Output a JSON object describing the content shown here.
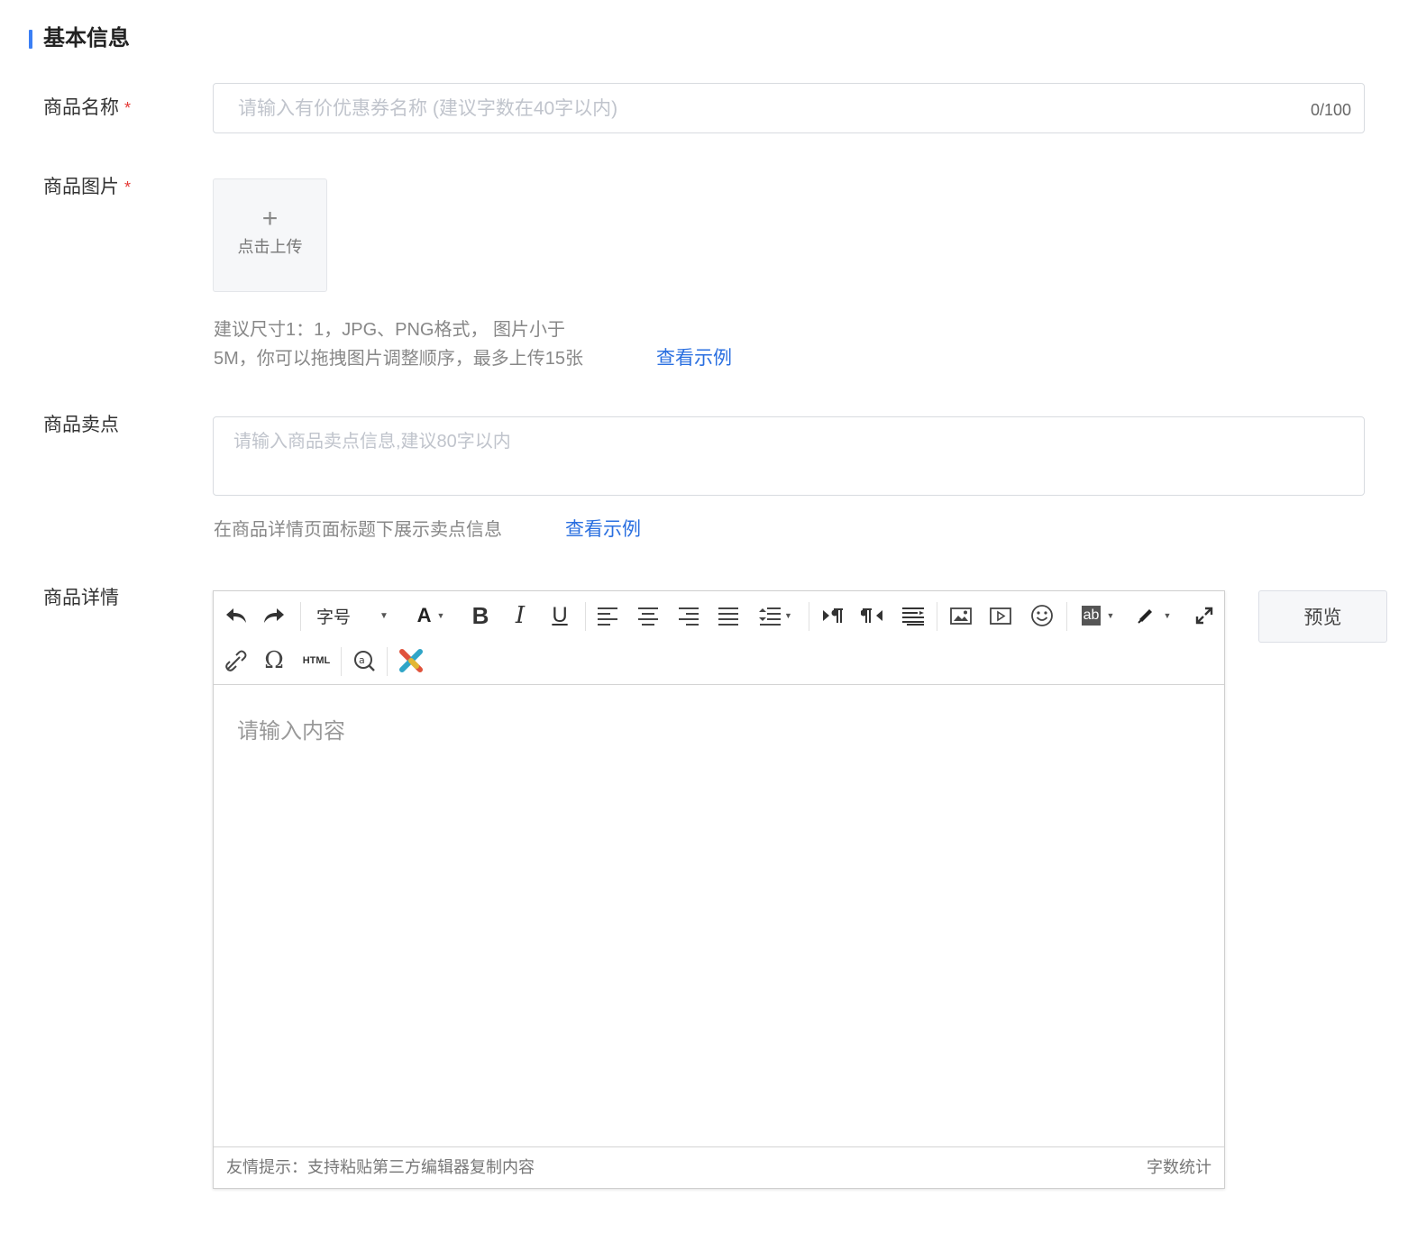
{
  "section": {
    "title": "基本信息"
  },
  "name_field": {
    "label": "商品名称",
    "required_mark": "*",
    "placeholder": "请输入有价优惠券名称 (建议字数在40字以内)",
    "counter": "0/100"
  },
  "image_field": {
    "label": "商品图片",
    "required_mark": "*",
    "upload_plus": "+",
    "upload_text": "点击上传",
    "hint_line1": "建议尺寸1：1，JPG、PNG格式， 图片小于",
    "hint_line2": "5M，你可以拖拽图片调整顺序，最多上传15张",
    "example_link": "查看示例"
  },
  "selling_field": {
    "label": "商品卖点",
    "placeholder": "请输入商品卖点信息,建议80字以内",
    "hint": "在商品详情页面标题下展示卖点信息",
    "example_link": "查看示例"
  },
  "detail_field": {
    "label": "商品详情",
    "toolbar": {
      "font_size_label": "字号",
      "html_label": "HTML",
      "icons": [
        "undo-icon",
        "redo-icon",
        "font-size-dropdown",
        "font-color-icon",
        "bold-icon",
        "italic-icon",
        "underline-icon",
        "align-left-icon",
        "align-center-icon",
        "align-right-icon",
        "align-justify-icon",
        "line-height-icon",
        "ltr-icon",
        "rtl-icon",
        "paragraph-format-icon",
        "image-icon",
        "video-icon",
        "emoji-icon",
        "background-color-icon",
        "format-brush-icon",
        "fullscreen-icon",
        "link-icon",
        "special-char-icon",
        "html-source-icon",
        "search-replace-icon",
        "clear-format-icon"
      ]
    },
    "content_placeholder": "请输入内容",
    "footer_tip": "友情提示：支持粘贴第三方编辑器复制内容",
    "word_count": "字数统计"
  },
  "preview_button": "预览",
  "colors": {
    "accent": "#3b7ff5",
    "link": "#2a6fe0",
    "required": "#e53935"
  }
}
